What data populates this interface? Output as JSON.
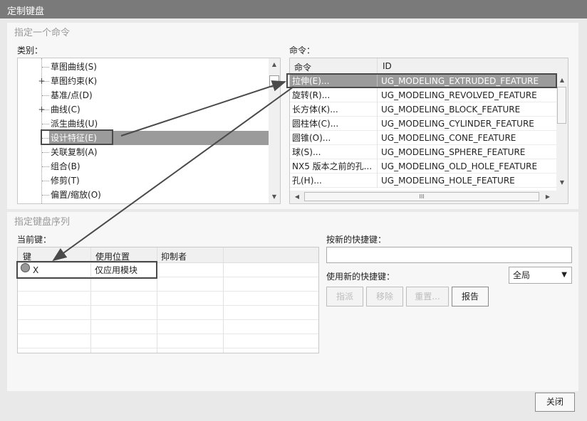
{
  "window": {
    "title": "定制键盘"
  },
  "specify_command": {
    "group_title": "指定一个命令",
    "category_label": "类别：",
    "command_label": "命令：",
    "category_tree": [
      {
        "label": "草图曲线(S)",
        "expandable": false,
        "selected": false
      },
      {
        "label": "草图约束(K)",
        "expandable": true,
        "selected": false
      },
      {
        "label": "基准/点(D)",
        "expandable": false,
        "selected": false
      },
      {
        "label": "曲线(C)",
        "expandable": true,
        "selected": false
      },
      {
        "label": "派生曲线(U)",
        "expandable": false,
        "selected": false
      },
      {
        "label": "设计特征(E)",
        "expandable": false,
        "selected": true
      },
      {
        "label": "关联复制(A)",
        "expandable": false,
        "selected": false
      },
      {
        "label": "组合(B)",
        "expandable": false,
        "selected": false
      },
      {
        "label": "修剪(T)",
        "expandable": false,
        "selected": false
      },
      {
        "label": "偏置/缩放(O)",
        "expandable": false,
        "selected": false
      }
    ],
    "command_columns": [
      "命令",
      "ID"
    ],
    "commands": [
      {
        "name": "拉伸(E)...",
        "id": "UG_MODELING_EXTRUDED_FEATURE",
        "selected": true
      },
      {
        "name": "旋转(R)...",
        "id": "UG_MODELING_REVOLVED_FEATURE",
        "selected": false
      },
      {
        "name": "长方体(K)...",
        "id": "UG_MODELING_BLOCK_FEATURE",
        "selected": false
      },
      {
        "name": "圆柱体(C)...",
        "id": "UG_MODELING_CYLINDER_FEATURE",
        "selected": false
      },
      {
        "name": "圆锥(O)...",
        "id": "UG_MODELING_CONE_FEATURE",
        "selected": false
      },
      {
        "name": "球(S)...",
        "id": "UG_MODELING_SPHERE_FEATURE",
        "selected": false
      },
      {
        "name": "NX5 版本之前的孔...",
        "id": "UG_MODELING_OLD_HOLE_FEATURE",
        "selected": false
      },
      {
        "name": "孔(H)...",
        "id": "UG_MODELING_HOLE_FEATURE",
        "selected": false
      }
    ],
    "hscroll_grip": "III"
  },
  "key_sequence": {
    "group_title": "指定键盘序列",
    "current_keys_label": "当前键：",
    "columns": [
      "键",
      "使用位置",
      "抑制者"
    ],
    "rows": [
      {
        "key": "X",
        "location": "仅应用模块",
        "suppressor": ""
      }
    ],
    "new_shortcut_label": "按新的快捷键：",
    "new_shortcut_value": "",
    "use_new_shortcut_label": "使用新的快捷键：",
    "scope_value": "全局",
    "buttons": {
      "assign": "指派",
      "remove": "移除",
      "reset": "重置...",
      "report": "报告"
    }
  },
  "footer": {
    "close_label": "关闭"
  },
  "colors": {
    "titlebar": "#7a7a7a",
    "selection": "#9b9b9b",
    "dialog_bg": "#e9e9e9",
    "highlight_box": "#4a4a4a"
  }
}
